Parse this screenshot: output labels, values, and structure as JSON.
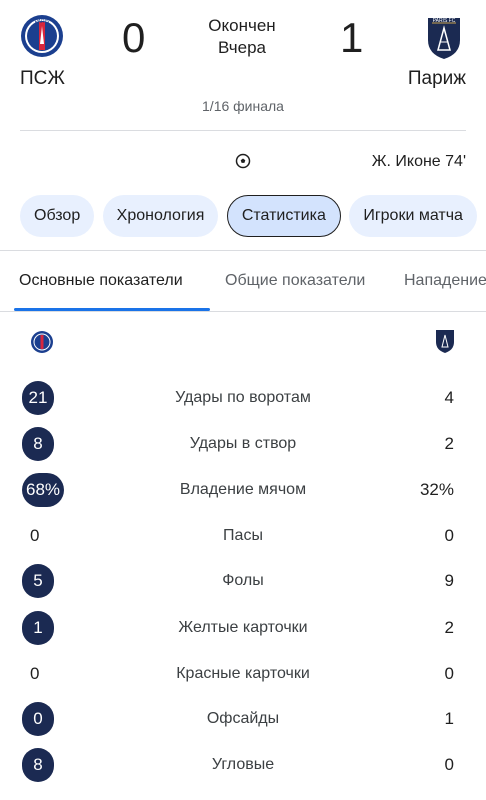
{
  "match": {
    "home": {
      "name": "ПСЖ",
      "score": "0",
      "logo_icon": "psg-crest-icon",
      "logo_text": "PARIS"
    },
    "away": {
      "name": "Париж",
      "score": "1",
      "logo_icon": "paris-fc-crest-icon",
      "logo_text": "PARIS FC"
    },
    "status": "Окончен",
    "date": "Вчера",
    "round": "1/16 финала",
    "goal": {
      "icon": "soccer-ball-icon",
      "scorer": "Ж. Иконе 74'"
    }
  },
  "tabs": [
    {
      "label": "Обзор",
      "active": false
    },
    {
      "label": "Хронология",
      "active": false
    },
    {
      "label": "Статистика",
      "active": true
    },
    {
      "label": "Игроки матча",
      "active": false
    }
  ],
  "subtabs": [
    {
      "label": "Основные показатели",
      "active": true
    },
    {
      "label": "Общие показатели",
      "active": false
    },
    {
      "label": "Нападение",
      "active": false
    }
  ],
  "stats": [
    {
      "label": "Удары по воротам",
      "home": "21",
      "away": "4",
      "home_highlight": true
    },
    {
      "label": "Удары в створ",
      "home": "8",
      "away": "2",
      "home_highlight": true
    },
    {
      "label": "Владение мячом",
      "home": "68%",
      "away": "32%",
      "home_highlight": true
    },
    {
      "label": "Пасы",
      "home": "0",
      "away": "0",
      "home_highlight": false
    },
    {
      "label": "Фолы",
      "home": "5",
      "away": "9",
      "home_highlight": true
    },
    {
      "label": "Желтые карточки",
      "home": "1",
      "away": "2",
      "home_highlight": true
    },
    {
      "label": "Красные карточки",
      "home": "0",
      "away": "0",
      "home_highlight": false
    },
    {
      "label": "Офсайды",
      "home": "0",
      "away": "1",
      "home_highlight": true
    },
    {
      "label": "Угловые",
      "home": "8",
      "away": "0",
      "home_highlight": true
    }
  ],
  "colors": {
    "accent": "#1a73e8",
    "pill": "#1b2a52",
    "chip": "#e8f0fe",
    "chip_active": "#d3e3fd"
  }
}
